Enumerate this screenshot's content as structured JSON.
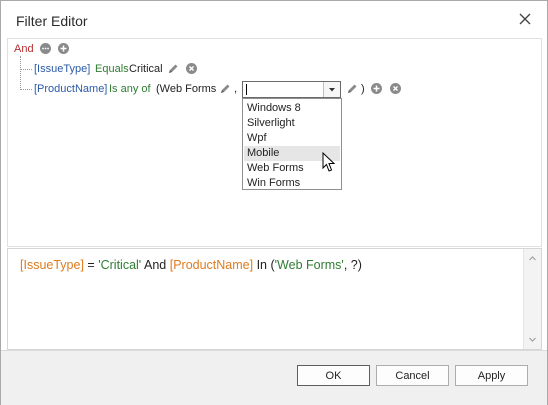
{
  "window": {
    "title": "Filter Editor"
  },
  "tree": {
    "group_operator": "And",
    "conditions": [
      {
        "field": "[IssueType]",
        "operator": "Equals",
        "value": "Critical"
      },
      {
        "field": "[ProductName]",
        "operator": "Is any of",
        "value_prefix": "(Web Forms",
        "separator": ",",
        "close_paren": ")"
      }
    ]
  },
  "combo": {
    "value": ""
  },
  "dropdown": {
    "items": [
      "Windows 8",
      "Silverlight",
      "Wpf",
      "Mobile",
      "Web Forms",
      "Win Forms"
    ],
    "hovered_item": "Mobile"
  },
  "expression": {
    "part1_field": "[IssueType]",
    "part1_op": "=",
    "part1_value": "'Critical'",
    "and": "And",
    "part2_field": "[ProductName]",
    "part2_op": "In",
    "part2_open": "(",
    "part2_value": "'Web Forms'",
    "part2_rest": ", ?)"
  },
  "buttons": {
    "ok": "OK",
    "cancel": "Cancel",
    "apply": "Apply"
  },
  "colors": {
    "group_operator": "#b33030",
    "field": "#2b5aa7",
    "operator": "#2e7d32",
    "expr_field": "#e07b1e",
    "expr_value": "#2e7d32"
  },
  "icons": {
    "group_menu": "ellipsis-icon",
    "add": "plus-circle-icon",
    "remove": "x-circle-icon",
    "edit": "pencil-icon",
    "close": "close-icon",
    "dropdown": "chevron-down-icon",
    "cursor": "mouse-pointer-icon"
  }
}
